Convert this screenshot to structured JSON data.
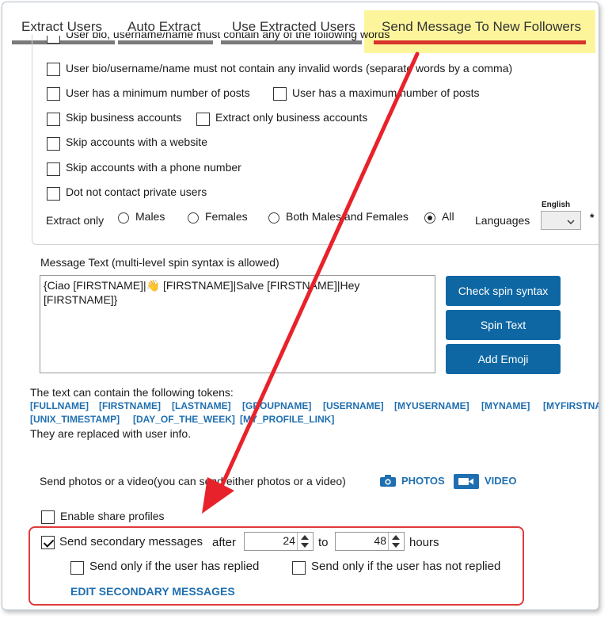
{
  "tabs": [
    {
      "label": "Extract Users"
    },
    {
      "label": "Auto Extract"
    },
    {
      "label": "Use Extracted Users"
    },
    {
      "label": "Send Message To New Followers"
    }
  ],
  "filters": {
    "partial_top": "User bio, username/name must contain any of the following words",
    "invalid_words": "User bio/username/name must not contain any invalid words (separate words by a comma)",
    "min_posts": "User has a minimum number of posts",
    "max_posts": "User has a maximum number of posts",
    "skip_business": "Skip business accounts",
    "only_business": "Extract only business accounts",
    "skip_website": "Skip accounts with a website",
    "skip_phone": "Skip accounts with a phone number",
    "no_private": "Dot not contact private users"
  },
  "gender": {
    "label": "Extract only",
    "options": [
      "Males",
      "Females",
      "Both Males and Females",
      "All"
    ],
    "selected": "All"
  },
  "languages": {
    "label": "Languages",
    "caption": "English",
    "value": "",
    "required_mark": "*"
  },
  "message": {
    "label": "Message Text  (multi-level spin syntax is allowed)",
    "text": "{Ciao [FIRSTNAME]|👋 [FIRSTNAME]|Salve [FIRSTNAME]|Hey\n[FIRSTNAME]}"
  },
  "buttons": {
    "check_spin": "Check spin syntax",
    "spin_text": "Spin Text",
    "add_emoji": "Add Emoji"
  },
  "tokens": {
    "intro": "The text can contain the following tokens:",
    "row1": [
      "[FULLNAME]",
      "[FIRSTNAME]",
      "[LASTNAME]",
      "[GROUPNAME]",
      "[USERNAME]",
      "[MYUSERNAME]",
      "[MYNAME]",
      "[MYFIRSTNA"
    ],
    "row2": [
      "[UNIX_TIMESTAMP]",
      "[DAY_OF_THE_WEEK]",
      "[MY_PROFILE_LINK]"
    ],
    "outro": "They are replaced with user info."
  },
  "media": {
    "label": "Send photos or a video(you can send either photos or a video)",
    "photos": "PHOTOS",
    "video": "VIDEO"
  },
  "share": {
    "label": "Enable share profiles"
  },
  "secondary": {
    "label": "Send secondary messages",
    "after": "after",
    "from_value": "24",
    "to": "to",
    "to_value": "48",
    "unit": "hours",
    "only_replied": "Send only if the user has replied",
    "only_not_replied": "Send only if the user has not replied",
    "edit_link": "EDIT SECONDARY MESSAGES"
  }
}
